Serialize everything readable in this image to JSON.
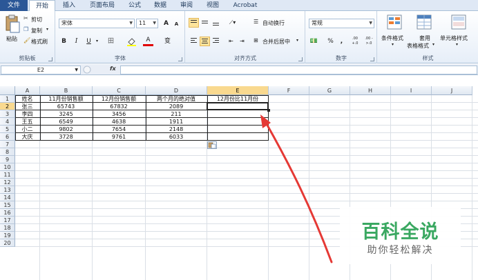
{
  "ribbon": {
    "tabs": [
      "文件",
      "开始",
      "插入",
      "页面布局",
      "公式",
      "数据",
      "审阅",
      "视图",
      "Acrobat"
    ],
    "active_tab": "开始",
    "clipboard": {
      "paste": "粘贴",
      "cut": "剪切",
      "copy": "复制",
      "copy_arrow": "▾",
      "format_painter": "格式刷",
      "label": "剪贴板"
    },
    "font": {
      "name": "宋体",
      "size": "11",
      "grow": "A",
      "shrink": "A",
      "bold": "B",
      "italic": "I",
      "underline": "U",
      "underline_arrow": "▾",
      "border": "田",
      "fill_a": "A",
      "font_color": "A",
      "wen": "变",
      "label": "字体"
    },
    "alignment": {
      "wrap": "自动换行",
      "merge": "合并后居中",
      "label": "对齐方式"
    },
    "number": {
      "format": "常规",
      "percent": "%",
      "comma": ",",
      "inc_decimal": ".00 +.0",
      "dec_decimal": ".00 ->.0",
      "label": "数字"
    },
    "styles": {
      "conditional": "条件格式",
      "table_format_1": "套用",
      "table_format_2": "表格格式",
      "cell_styles": "单元格样式",
      "label": "样式"
    }
  },
  "formula_bar": {
    "name_box": "E2",
    "fx": "fx",
    "content": ""
  },
  "grid": {
    "columns": [
      "A",
      "B",
      "C",
      "D",
      "E",
      "F",
      "G",
      "H",
      "I",
      "J"
    ],
    "selected_column": "E",
    "selected_row": "2",
    "rows": [
      "1",
      "2",
      "3",
      "4",
      "5",
      "6",
      "7",
      "8",
      "9",
      "10",
      "11",
      "12",
      "13",
      "14",
      "15",
      "16",
      "17",
      "18",
      "19",
      "20"
    ],
    "cells": [
      [
        "姓名",
        "11月份销售额",
        "12月份销售额",
        "两个月的绝对值",
        "12月份比11月份"
      ],
      [
        "张三",
        "65743",
        "67832",
        "2089",
        ""
      ],
      [
        "李四",
        "3245",
        "3456",
        "211",
        ""
      ],
      [
        "王五",
        "6549",
        "4638",
        "1911",
        ""
      ],
      [
        "小二",
        "9802",
        "7654",
        "2148",
        ""
      ],
      [
        "大庆",
        "3728",
        "9761",
        "6033",
        ""
      ]
    ]
  },
  "watermark": {
    "title": "百科全说",
    "subtitle": "助你轻松解决"
  }
}
